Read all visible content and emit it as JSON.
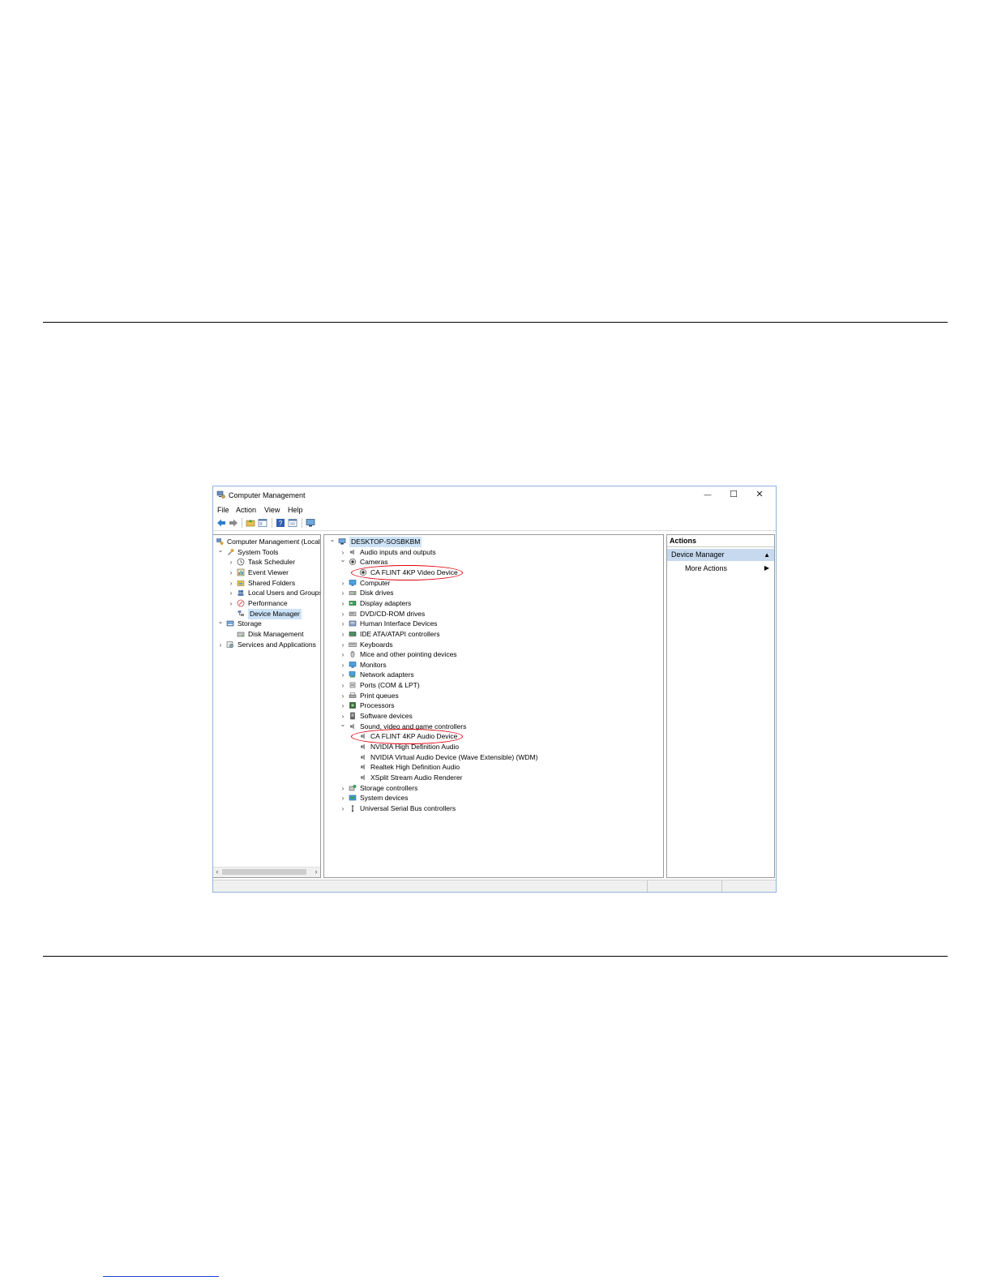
{
  "window": {
    "title": "Computer Management",
    "controls": {
      "minimize": "—",
      "maximize": "☐",
      "close": "✕"
    }
  },
  "menu": [
    "File",
    "Action",
    "View",
    "Help"
  ],
  "toolbar_icons": [
    "back-arrow-icon",
    "forward-arrow-icon",
    "up-folder-icon",
    "show-hide-console-tree-icon",
    "help-icon",
    "properties-icon",
    "monitor-icon"
  ],
  "left_tree": [
    {
      "label": "Computer Management (Local",
      "depth": 0,
      "chevron": "",
      "icon": "computer-management-icon"
    },
    {
      "label": "System Tools",
      "depth": 1,
      "chevron": "expanded",
      "icon": "tools-icon"
    },
    {
      "label": "Task Scheduler",
      "depth": 2,
      "chevron": "collapsed",
      "icon": "clock-icon"
    },
    {
      "label": "Event Viewer",
      "depth": 2,
      "chevron": "collapsed",
      "icon": "event-viewer-icon"
    },
    {
      "label": "Shared Folders",
      "depth": 2,
      "chevron": "collapsed",
      "icon": "shared-folder-icon"
    },
    {
      "label": "Local Users and Groups",
      "depth": 2,
      "chevron": "collapsed",
      "icon": "users-icon"
    },
    {
      "label": "Performance",
      "depth": 2,
      "chevron": "collapsed",
      "icon": "performance-icon"
    },
    {
      "label": "Device Manager",
      "depth": 2,
      "chevron": "",
      "icon": "device-manager-icon",
      "selected": true
    },
    {
      "label": "Storage",
      "depth": 1,
      "chevron": "expanded",
      "icon": "storage-icon"
    },
    {
      "label": "Disk Management",
      "depth": 2,
      "chevron": "",
      "icon": "disk-management-icon"
    },
    {
      "label": "Services and Applications",
      "depth": 1,
      "chevron": "collapsed",
      "icon": "services-icon"
    }
  ],
  "device_tree": [
    {
      "label": "DESKTOP-SOSBKBM",
      "depth": 0,
      "chevron": "expanded",
      "icon": "computer-icon",
      "root": true
    },
    {
      "label": "Audio inputs and outputs",
      "depth": 1,
      "chevron": "collapsed",
      "icon": "speaker-icon"
    },
    {
      "label": "Cameras",
      "depth": 1,
      "chevron": "expanded",
      "icon": "camera-icon"
    },
    {
      "label": "CA FLINT 4KP Video Device",
      "depth": 2,
      "chevron": "",
      "icon": "camera-icon",
      "highlighted": true
    },
    {
      "label": "Computer",
      "depth": 1,
      "chevron": "collapsed",
      "icon": "monitor-icon"
    },
    {
      "label": "Disk drives",
      "depth": 1,
      "chevron": "collapsed",
      "icon": "disk-drive-icon"
    },
    {
      "label": "Display adapters",
      "depth": 1,
      "chevron": "collapsed",
      "icon": "display-adapter-icon"
    },
    {
      "label": "DVD/CD-ROM drives",
      "depth": 1,
      "chevron": "collapsed",
      "icon": "dvd-drive-icon"
    },
    {
      "label": "Human Interface Devices",
      "depth": 1,
      "chevron": "collapsed",
      "icon": "hid-icon"
    },
    {
      "label": "IDE ATA/ATAPI controllers",
      "depth": 1,
      "chevron": "collapsed",
      "icon": "ide-controller-icon"
    },
    {
      "label": "Keyboards",
      "depth": 1,
      "chevron": "collapsed",
      "icon": "keyboard-icon"
    },
    {
      "label": "Mice and other pointing devices",
      "depth": 1,
      "chevron": "collapsed",
      "icon": "mouse-icon"
    },
    {
      "label": "Monitors",
      "depth": 1,
      "chevron": "collapsed",
      "icon": "monitor-icon"
    },
    {
      "label": "Network adapters",
      "depth": 1,
      "chevron": "collapsed",
      "icon": "network-adapter-icon"
    },
    {
      "label": "Ports (COM & LPT)",
      "depth": 1,
      "chevron": "collapsed",
      "icon": "port-icon"
    },
    {
      "label": "Print queues",
      "depth": 1,
      "chevron": "collapsed",
      "icon": "printer-icon"
    },
    {
      "label": "Processors",
      "depth": 1,
      "chevron": "collapsed",
      "icon": "processor-icon"
    },
    {
      "label": "Software devices",
      "depth": 1,
      "chevron": "collapsed",
      "icon": "software-device-icon"
    },
    {
      "label": "Sound, video and game controllers",
      "depth": 1,
      "chevron": "expanded",
      "icon": "speaker-icon"
    },
    {
      "label": "CA FLINT 4KP Audio Device",
      "depth": 2,
      "chevron": "",
      "icon": "speaker-icon",
      "highlighted": true
    },
    {
      "label": "NVIDIA High Definition Audio",
      "depth": 2,
      "chevron": "",
      "icon": "speaker-icon"
    },
    {
      "label": "NVIDIA Virtual Audio Device (Wave Extensible) (WDM)",
      "depth": 2,
      "chevron": "",
      "icon": "speaker-icon"
    },
    {
      "label": "Realtek High Definition Audio",
      "depth": 2,
      "chevron": "",
      "icon": "speaker-icon"
    },
    {
      "label": "XSplit  Stream  Audio  Renderer",
      "depth": 2,
      "chevron": "",
      "icon": "speaker-icon"
    },
    {
      "label": "Storage controllers",
      "depth": 1,
      "chevron": "collapsed",
      "icon": "storage-controller-icon"
    },
    {
      "label": "System devices",
      "depth": 1,
      "chevron": "collapsed",
      "icon": "system-device-icon"
    },
    {
      "label": "Universal Serial Bus controllers",
      "depth": 1,
      "chevron": "collapsed",
      "icon": "usb-icon"
    }
  ],
  "actions": {
    "header": "Actions",
    "section": "Device Manager",
    "more": "More Actions"
  },
  "colors": {
    "highlight_ring": "#e0000f",
    "selection": "#cde3f7",
    "actions_band": "#c6d9ef",
    "window_border": "#8fb3dd"
  }
}
